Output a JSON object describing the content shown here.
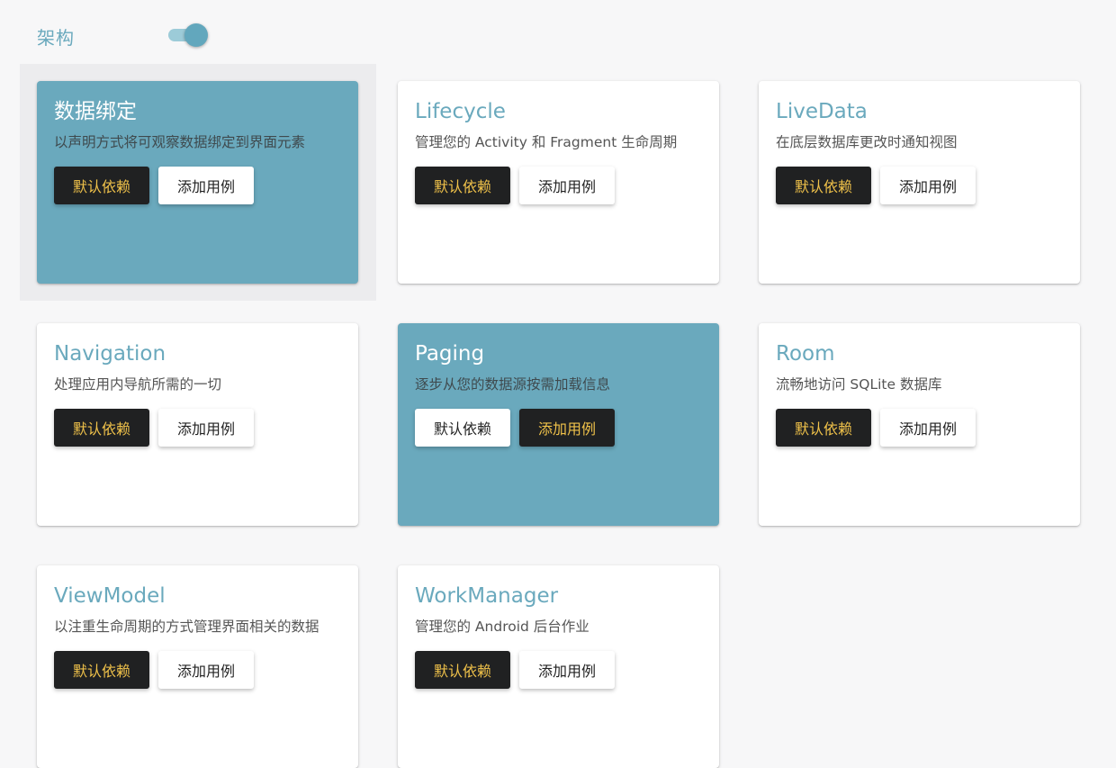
{
  "header": {
    "section_title": "架构",
    "toggle_on": true
  },
  "colors": {
    "accent": "#6aa9bd",
    "dark_button": "#202122",
    "dark_button_text": "#f0c24a"
  },
  "cards": [
    {
      "title": "数据绑定",
      "desc": "以声明方式将可观察数据绑定到界面元素",
      "btn1": "默认依赖",
      "btn2": "添加用例",
      "active": true,
      "btn1_style": "dark",
      "btn2_style": "light"
    },
    {
      "title": "Lifecycle",
      "desc": "管理您的 Activity 和 Fragment 生命周期",
      "btn1": "默认依赖",
      "btn2": "添加用例",
      "active": false,
      "btn1_style": "dark",
      "btn2_style": "light"
    },
    {
      "title": "LiveData",
      "desc": "在底层数据库更改时通知视图",
      "btn1": "默认依赖",
      "btn2": "添加用例",
      "active": false,
      "btn1_style": "dark",
      "btn2_style": "light"
    },
    {
      "title": "Navigation",
      "desc": "处理应用内导航所需的一切",
      "btn1": "默认依赖",
      "btn2": "添加用例",
      "active": false,
      "btn1_style": "dark",
      "btn2_style": "light"
    },
    {
      "title": "Paging",
      "desc": "逐步从您的数据源按需加载信息",
      "btn1": "默认依赖",
      "btn2": "添加用例",
      "active": true,
      "btn1_style": "light",
      "btn2_style": "dark"
    },
    {
      "title": "Room",
      "desc": "流畅地访问 SQLite 数据库",
      "btn1": "默认依赖",
      "btn2": "添加用例",
      "active": false,
      "btn1_style": "dark",
      "btn2_style": "light"
    },
    {
      "title": "ViewModel",
      "desc": "以注重生命周期的方式管理界面相关的数据",
      "btn1": "默认依赖",
      "btn2": "添加用例",
      "active": false,
      "btn1_style": "dark",
      "btn2_style": "light"
    },
    {
      "title": "WorkManager",
      "desc": "管理您的 Android 后台作业",
      "btn1": "默认依赖",
      "btn2": "添加用例",
      "active": false,
      "btn1_style": "dark",
      "btn2_style": "light"
    }
  ]
}
